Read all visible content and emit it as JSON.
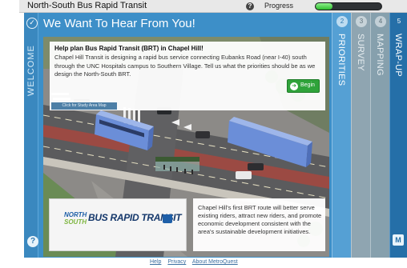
{
  "header": {
    "app_title": "North-South Bus Rapid Transit",
    "help_glyph": "?",
    "progress_label": "Progress",
    "progress_fraction": 0.25
  },
  "welcome": {
    "label": "WELCOME",
    "heading": "We Want To Hear From You!"
  },
  "intro": {
    "heading": "Help plan Bus Rapid Transit (BRT) in Chapel Hill!",
    "body": "Chapel Hill Transit is designing a rapid bus service connecting Eubanks Road (near I-40) south through the UNC Hospitals campus to Southern Village. Tell us what the priorities should be as we design the North-South BRT.",
    "study_map_link": "Click for Study Area Map",
    "begin_label": "Begin"
  },
  "logo": {
    "north": "NORTH",
    "south": "SOUTH",
    "main": "BUS RAPID TRANSIT"
  },
  "note": {
    "text": "Chapel Hill's first BRT route will better serve existing riders, attract new riders, and promote economic development consistent with the area's sustainable development initiatives."
  },
  "tabs": [
    {
      "number": "2",
      "label": "PRIORITIES"
    },
    {
      "number": "3",
      "label": "SURVEY"
    },
    {
      "number": "4",
      "label": "MAPPING"
    },
    {
      "number": "5",
      "label": "WRAP-UP"
    }
  ],
  "footer": {
    "links": [
      "Help",
      "Privacy",
      "About MetroQuest"
    ]
  },
  "colors": {
    "panel_blue": "#3d8fc8",
    "begin_green": "#2fa33a",
    "bus_blue": "#6b8ed8"
  }
}
